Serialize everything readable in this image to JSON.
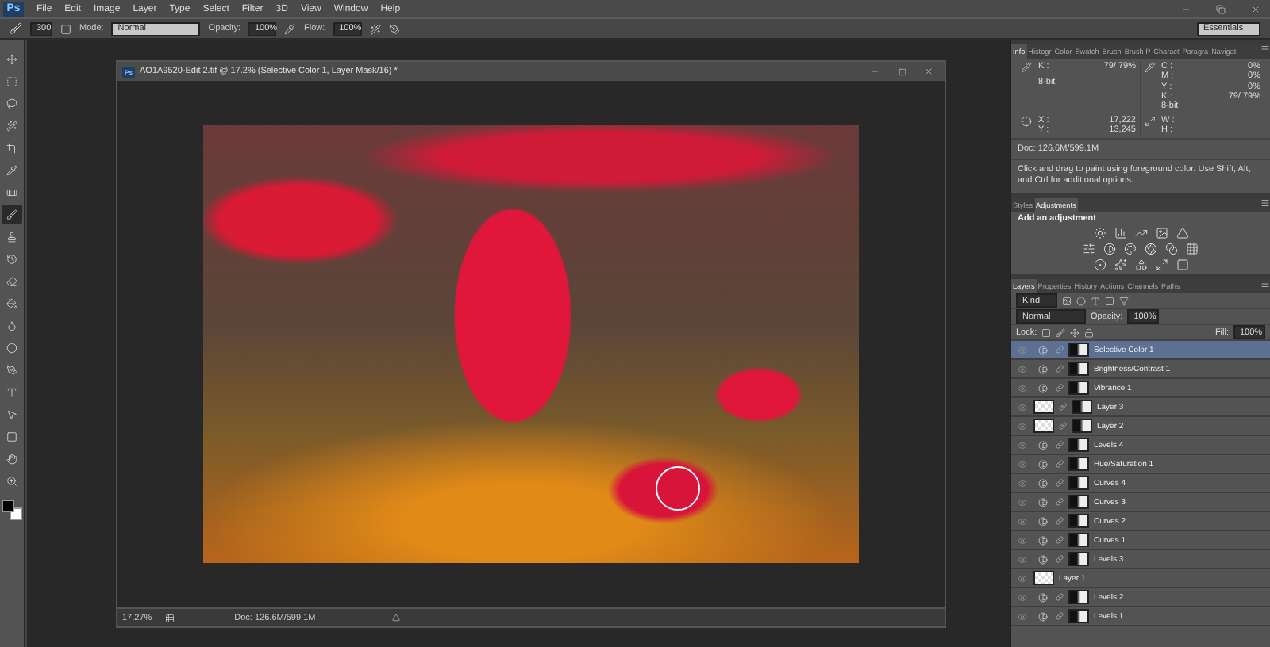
{
  "app": {
    "logo": "Ps",
    "menu": [
      "File",
      "Edit",
      "Image",
      "Layer",
      "Type",
      "Select",
      "Filter",
      "3D",
      "View",
      "Window",
      "Help"
    ]
  },
  "options_bar": {
    "brush_size": "300",
    "mode_label": "Mode:",
    "mode": "Normal",
    "opacity_label": "Opacity:",
    "opacity": "100%",
    "flow_label": "Flow:",
    "flow": "100%",
    "workspace": "Essentials"
  },
  "tools": [
    {
      "kind": "move",
      "selected": false
    },
    {
      "kind": "marquee",
      "selected": false
    },
    {
      "kind": "lasso",
      "selected": false
    },
    {
      "kind": "wand",
      "selected": false
    },
    {
      "kind": "crop",
      "selected": false
    },
    {
      "kind": "eyedropper",
      "selected": false
    },
    {
      "kind": "heal",
      "selected": false
    },
    {
      "kind": "brush",
      "selected": true
    },
    {
      "kind": "stamp",
      "selected": false
    },
    {
      "kind": "history",
      "selected": false
    },
    {
      "kind": "eraser",
      "selected": false
    },
    {
      "kind": "bucket",
      "selected": false
    },
    {
      "kind": "blur",
      "selected": false
    },
    {
      "kind": "dodge",
      "selected": false
    },
    {
      "kind": "pen",
      "selected": false
    },
    {
      "kind": "type",
      "selected": false
    },
    {
      "kind": "select",
      "selected": false
    },
    {
      "kind": "shape",
      "selected": false
    },
    {
      "kind": "hand",
      "selected": false
    },
    {
      "kind": "zoom",
      "selected": false
    }
  ],
  "document": {
    "icon": "Ps",
    "title": "AO1A9520-Edit 2.tif @ 17.2% (Selective Color 1, Layer Mask/16) *",
    "zoom": "17.27%",
    "doc_size": "Doc: 126.6M/599.1M"
  },
  "info_panel": {
    "tabs": [
      {
        "label": "Info",
        "selected": true
      },
      {
        "label": "Histogr",
        "selected": false
      },
      {
        "label": "Color",
        "selected": false
      },
      {
        "label": "Swatch",
        "selected": false
      },
      {
        "label": "Brush",
        "selected": false
      },
      {
        "label": "Brush P",
        "selected": false
      },
      {
        "label": "Charact",
        "selected": false
      },
      {
        "label": "Paragra",
        "selected": false
      },
      {
        "label": "Navigat",
        "selected": false
      }
    ],
    "gray": [
      {
        "label": "K :",
        "value": "79/ 79%"
      }
    ],
    "gray_bits": "8-bit",
    "cmyk": [
      {
        "label": "C :",
        "value": "0%"
      },
      {
        "label": "M :",
        "value": "0%"
      },
      {
        "label": "Y :",
        "value": "0%"
      },
      {
        "label": "K :",
        "value": "79/ 79%"
      }
    ],
    "cmyk_bits": "8-bit",
    "position": [
      {
        "label": "X :",
        "value": "17,222"
      },
      {
        "label": "Y :",
        "value": "13,245"
      }
    ],
    "size": [
      {
        "label": "W :"
      },
      {
        "label": "H :"
      }
    ],
    "doc_size": "Doc: 126.6M/599.1M",
    "help": "Click and drag to paint using foreground color. Use Shift, Alt, and Ctrl for additional options."
  },
  "adjustments_panel": {
    "tabs": [
      {
        "label": "Styles",
        "selected": false
      },
      {
        "label": "Adjustments",
        "selected": true
      }
    ],
    "heading": "Add an adjustment"
  },
  "layers_panel": {
    "tabs": [
      {
        "label": "Layers",
        "selected": true
      },
      {
        "label": "Properties",
        "selected": false
      },
      {
        "label": "History",
        "selected": false
      },
      {
        "label": "Actions",
        "selected": false
      },
      {
        "label": "Channels",
        "selected": false
      },
      {
        "label": "Paths",
        "selected": false
      }
    ],
    "filter": "Kind",
    "blend_mode": "Normal",
    "opacity_label": "Opacity:",
    "opacity": "100%",
    "lock_label": "Lock:",
    "fill_label": "Fill:",
    "fill": "100%",
    "layers": [
      {
        "name": "Selective Color 1",
        "kind": "adjustment",
        "visible": true,
        "selected": true
      },
      {
        "name": "Brightness/Contrast 1",
        "kind": "adjustment",
        "visible": true,
        "selected": false
      },
      {
        "name": "Vibrance 1",
        "kind": "adjustment",
        "visible": true,
        "selected": false
      },
      {
        "name": "Layer 3",
        "kind": "masked",
        "visible": true,
        "selected": false
      },
      {
        "name": "Layer 2",
        "kind": "masked",
        "visible": true,
        "selected": false
      },
      {
        "name": "Levels 4",
        "kind": "adjustment",
        "visible": true,
        "selected": false
      },
      {
        "name": "Hue/Saturation 1",
        "kind": "adjustment",
        "visible": true,
        "selected": false
      },
      {
        "name": "Curves 4",
        "kind": "adjustment",
        "visible": true,
        "selected": false
      },
      {
        "name": "Curves 3",
        "kind": "adjustment",
        "visible": true,
        "selected": false
      },
      {
        "name": "Curves 2",
        "kind": "adjustment",
        "visible": true,
        "selected": false
      },
      {
        "name": "Curves 1",
        "kind": "adjustment",
        "visible": true,
        "selected": false
      },
      {
        "name": "Levels 3",
        "kind": "adjustment",
        "visible": true,
        "selected": false
      },
      {
        "name": "Layer 1",
        "kind": "pixel",
        "visible": true,
        "selected": false
      },
      {
        "name": "Levels 2",
        "kind": "adjustment",
        "visible": true,
        "selected": false
      },
      {
        "name": "Levels 1",
        "kind": "adjustment",
        "visible": true,
        "selected": false
      }
    ]
  }
}
